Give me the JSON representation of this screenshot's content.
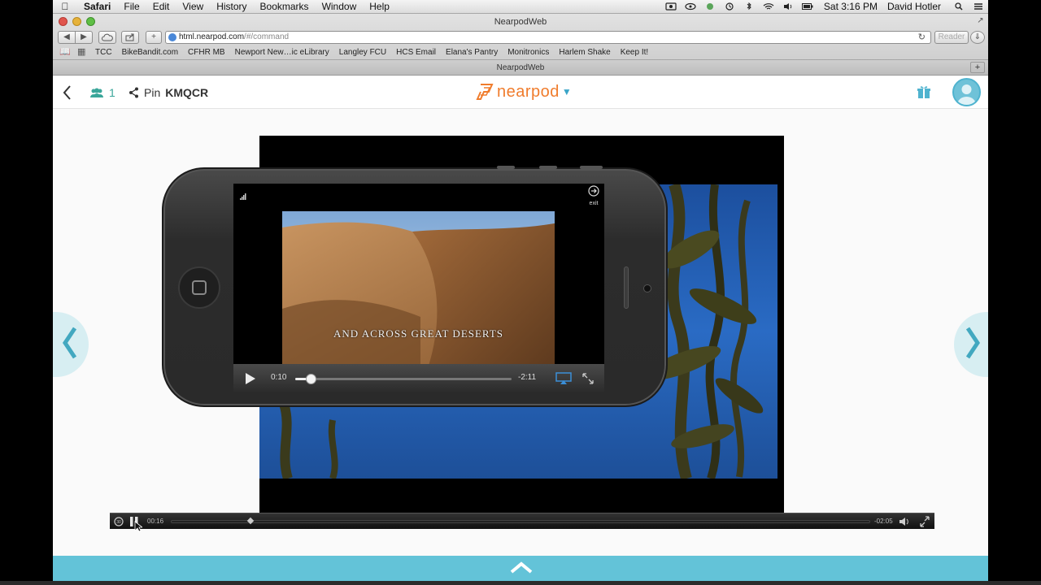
{
  "menubar": {
    "app_name": "Safari",
    "menus": [
      "File",
      "Edit",
      "View",
      "History",
      "Bookmarks",
      "Window",
      "Help"
    ],
    "clock": "Sat 3:16 PM",
    "user": "David Hotler"
  },
  "browser": {
    "window_title": "NearpodWeb",
    "url_host": "html.nearpod.com",
    "url_path": "/#/command",
    "reader_label": "Reader",
    "bookmarks": [
      "TCC",
      "BikeBandit.com",
      "CFHR MB",
      "Newport New…ic eLibrary",
      "Langley FCU",
      "HCS Email",
      "Elana's Pantry",
      "Monitronics",
      "Harlem Shake",
      "Keep It!"
    ],
    "tab_title": "NearpodWeb"
  },
  "nearpod": {
    "participant_count": "1",
    "pin_label": "Pin",
    "pin_code": "KMQCR",
    "logo_text": "nearpod",
    "accent_color": "#63c3d8",
    "logo_color": "#f07c2c"
  },
  "phone_video": {
    "caption": "AND ACROSS GREAT DESERTS",
    "exit_label": "exit",
    "current_time": "0:10",
    "remaining_time": "-2:11",
    "progress": 0.07
  },
  "slide_video": {
    "current_time": "00:16",
    "remaining_time": "-02:05",
    "progress": 0.11
  },
  "icons": [
    "apple-icon",
    "globe-icon",
    "participants-icon",
    "share-icon",
    "gift-icon",
    "avatar-icon",
    "play-icon",
    "airplay-icon",
    "expand-icon",
    "pause-icon",
    "volume-icon",
    "fullscreen-icon",
    "chevron-left-icon",
    "chevron-right-icon",
    "chevron-up-icon"
  ]
}
